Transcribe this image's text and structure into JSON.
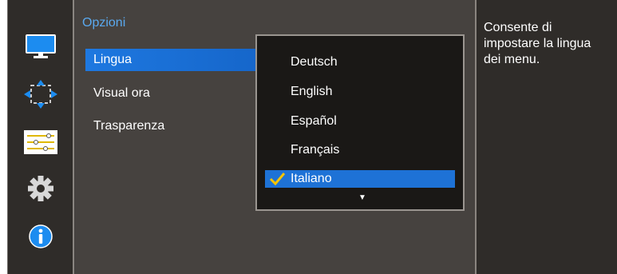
{
  "sidebar": {
    "icons": [
      {
        "name": "monitor-icon",
        "selected": false
      },
      {
        "name": "position-arrows-icon",
        "selected": false
      },
      {
        "name": "settings-sliders-icon",
        "selected": true
      },
      {
        "name": "gear-icon",
        "selected": false
      },
      {
        "name": "info-icon",
        "selected": false
      }
    ]
  },
  "panel": {
    "title": "Opzioni",
    "items": [
      {
        "label": "Lingua",
        "active": true
      },
      {
        "label": "Visual ora",
        "active": false
      },
      {
        "label": "Trasparenza",
        "active": false
      }
    ]
  },
  "dropdown": {
    "options": [
      "Deutsch",
      "English",
      "Español",
      "Français",
      "Italiano"
    ],
    "selected": "Italiano",
    "more_icon": "triangle-down"
  },
  "help": {
    "text": "Consente di impostare la lingua dei menu."
  },
  "colors": {
    "accent": "#1e72d6",
    "title": "#5aa9ef",
    "check": "#f5c400"
  }
}
